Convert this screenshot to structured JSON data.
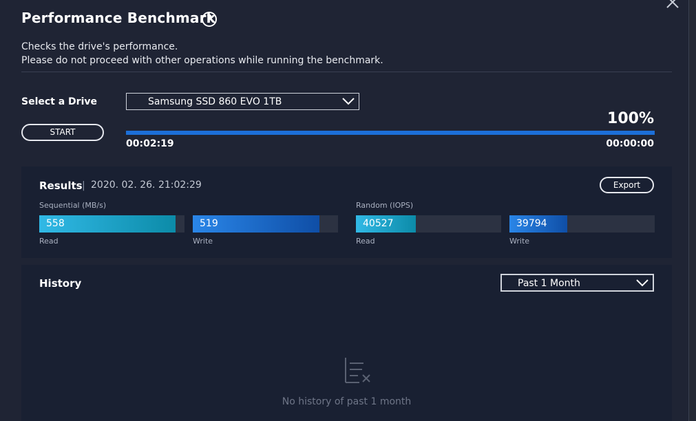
{
  "header": {
    "title": "Performance Benchmark",
    "help_glyph": "?",
    "description_lines": [
      "Checks the drive's performance.",
      "Please do not proceed with other operations while running the benchmark."
    ]
  },
  "drive": {
    "label": "Select a Drive",
    "selected": "Samsung SSD 860 EVO 1TB"
  },
  "benchmark": {
    "start_label": "START",
    "progress_percent": 100,
    "progress_text": "100%",
    "elapsed": "00:02:19",
    "remaining": "00:00:00"
  },
  "results": {
    "title": "Results",
    "separator": "|",
    "timestamp": "2020. 02. 26. 21:02:29",
    "export_label": "Export",
    "sequential": {
      "label": "Sequential (MB/s)",
      "read": {
        "value": "558",
        "label": "Read",
        "fill_fraction": 0.94
      },
      "write": {
        "value": "519",
        "label": "Write",
        "fill_fraction": 0.87
      }
    },
    "random": {
      "label": "Random (IOPS)",
      "read": {
        "value": "40527",
        "label": "Read",
        "fill_fraction": 0.41
      },
      "write": {
        "value": "39794",
        "label": "Write",
        "fill_fraction": 0.4
      }
    }
  },
  "history": {
    "title": "History",
    "period_selected": "Past 1 Month",
    "empty_message": "No history of past 1 month"
  },
  "colors": {
    "accent_blue": "#1c6fd8",
    "sequential_read_gradient": [
      "#31b9e6",
      "#0c8ba8"
    ],
    "write_gradient": [
      "#2a86e8",
      "#0f4ea6"
    ],
    "random_read_gradient": [
      "#31b9e6",
      "#0c8ba8"
    ]
  },
  "icons": [
    "close-icon",
    "help-icon",
    "chevron-down-icon",
    "empty-history-icon"
  ]
}
